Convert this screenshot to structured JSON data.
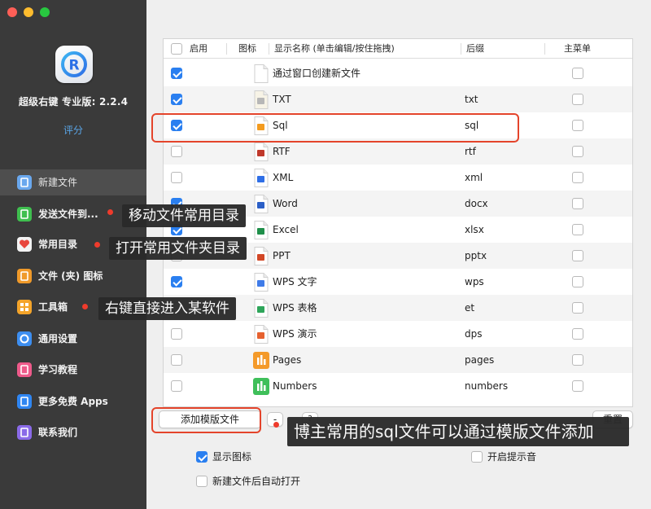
{
  "app": {
    "name": "超级右键 专业版: 2.2.4",
    "rate_link": "评分",
    "logo_letter": "R",
    "traffic_colors": [
      "#fe5f57",
      "#febc2e",
      "#28c840"
    ]
  },
  "sidebar": {
    "items": [
      {
        "label": "新建文件",
        "icon": "new-file-icon",
        "color": "#6aa8ee",
        "selected": true
      },
      {
        "label": "发送文件到...",
        "icon": "send-file-icon",
        "color": "#3fbf4f",
        "selected": false
      },
      {
        "label": "常用目录",
        "icon": "heart-icon",
        "color": "#f3f3f3",
        "selected": false
      },
      {
        "label": "文件 (夹) 图标",
        "icon": "folder-icon-icon",
        "color": "#f09a2a",
        "selected": false
      },
      {
        "label": "工具箱",
        "icon": "toolbox-icon",
        "color": "#f4a42a",
        "selected": false
      },
      {
        "label": "通用设置",
        "icon": "gear-icon",
        "color": "#3d8ef0",
        "selected": false
      },
      {
        "label": "学习教程",
        "icon": "tutorial-icon",
        "color": "#ee5a8a",
        "selected": false
      },
      {
        "label": "更多免费 Apps",
        "icon": "app-store-icon",
        "color": "#2f86f2",
        "selected": false
      },
      {
        "label": "联系我们",
        "icon": "contacts-icon",
        "color": "#8a6ae8",
        "selected": false
      }
    ]
  },
  "table": {
    "headers": {
      "enabled": "启用",
      "icon": "图标",
      "display_name": "显示名称 (单击编辑/按住拖拽)",
      "suffix": "后缀",
      "main_menu": "主菜单"
    },
    "rows": [
      {
        "enabled": true,
        "icon": "blank-file-icon",
        "name": "通过窗口创建新文件",
        "suffix": "",
        "main_menu": false
      },
      {
        "enabled": true,
        "icon": "txt-file-icon",
        "name": "TXT",
        "suffix": "txt",
        "main_menu": false
      },
      {
        "enabled": true,
        "icon": "sql-file-icon",
        "name": "Sql",
        "suffix": "sql",
        "main_menu": false
      },
      {
        "enabled": false,
        "icon": "rtf-file-icon",
        "name": "RTF",
        "suffix": "rtf",
        "main_menu": false
      },
      {
        "enabled": false,
        "icon": "xml-file-icon",
        "name": "XML",
        "suffix": "xml",
        "main_menu": false
      },
      {
        "enabled": true,
        "icon": "word-file-icon",
        "name": "Word",
        "suffix": "docx",
        "main_menu": false
      },
      {
        "enabled": true,
        "icon": "excel-file-icon",
        "name": "Excel",
        "suffix": "xlsx",
        "main_menu": false
      },
      {
        "enabled": false,
        "icon": "ppt-file-icon",
        "name": "PPT",
        "suffix": "pptx",
        "main_menu": false
      },
      {
        "enabled": true,
        "icon": "wps-writer-icon",
        "name": "WPS 文字",
        "suffix": "wps",
        "main_menu": false
      },
      {
        "enabled": false,
        "icon": "wps-sheet-icon",
        "name": "WPS 表格",
        "suffix": "et",
        "main_menu": false
      },
      {
        "enabled": false,
        "icon": "wps-presentation-icon",
        "name": "WPS 演示",
        "suffix": "dps",
        "main_menu": false
      },
      {
        "enabled": false,
        "icon": "pages-file-icon",
        "name": "Pages",
        "suffix": "pages",
        "main_menu": false
      },
      {
        "enabled": false,
        "icon": "numbers-file-icon",
        "name": "Numbers",
        "suffix": "numbers",
        "main_menu": false
      }
    ]
  },
  "buttons": {
    "add_template": "添加模版文件",
    "remove": "-",
    "help": "?",
    "reset": "重置"
  },
  "options": {
    "show_icons": "显示图标",
    "show_icons_checked": true,
    "open_after_create": "新建文件后自动打开",
    "open_after_create_checked": false,
    "prompt_sound": "开启提示音",
    "prompt_sound_checked": false
  },
  "annotations": {
    "tip_send": "移动文件常用目录",
    "tip_favorites": "打开常用文件夹目录",
    "tip_toolbox": "右键直接进入某软件",
    "tip_template": "博主常用的sql文件可以通过模版文件添加"
  }
}
